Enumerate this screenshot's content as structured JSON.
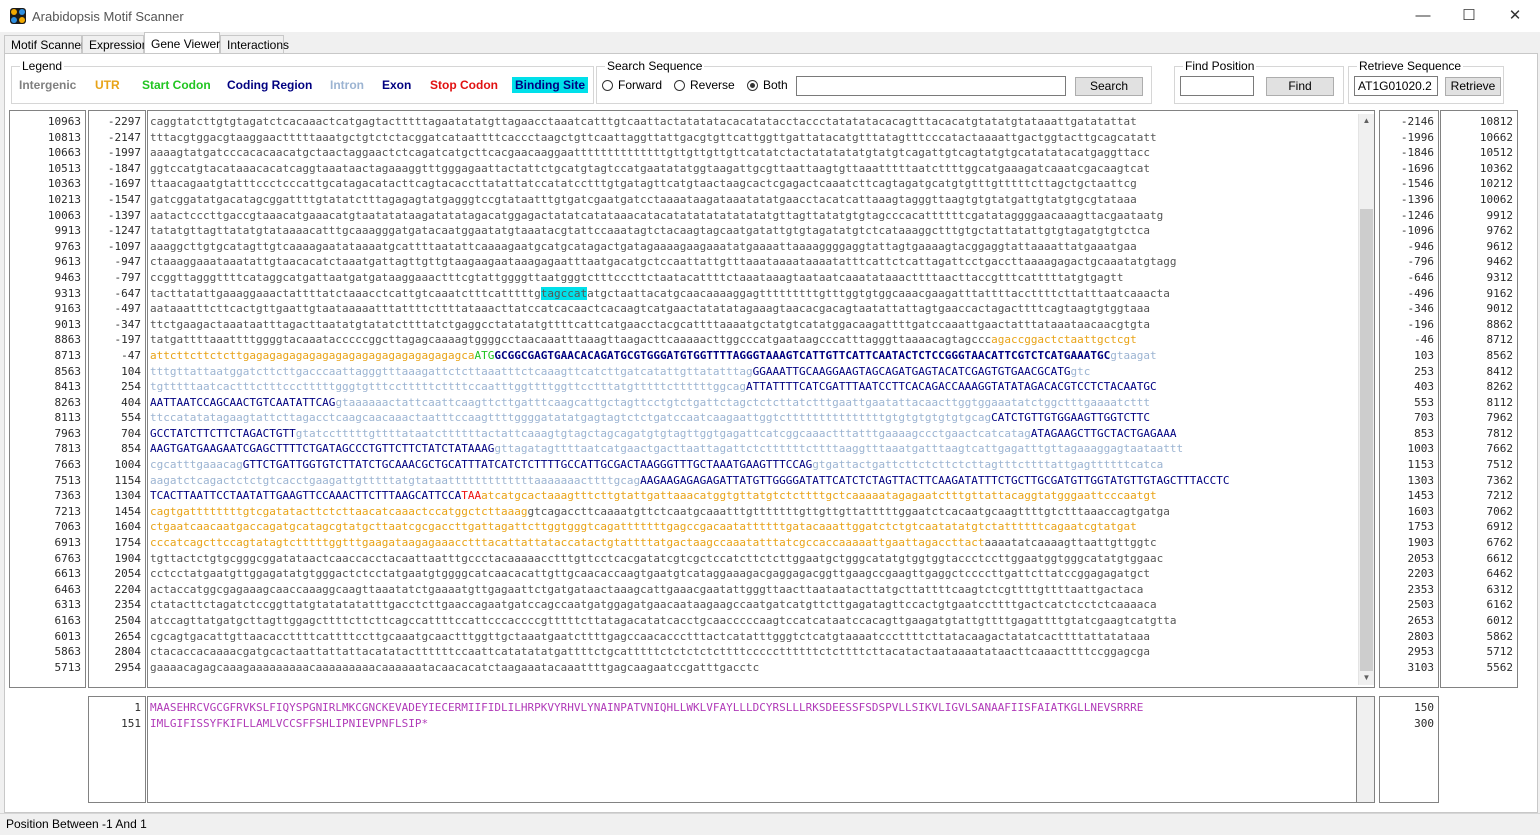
{
  "window": {
    "title": "Arabidopsis Motif Scanner",
    "minimize": "—",
    "maximize": "☐",
    "close": "✕"
  },
  "tabs": [
    {
      "label": "Motif Scanner"
    },
    {
      "label": "Expression"
    },
    {
      "label": "Gene Viewer"
    },
    {
      "label": "Interactions"
    }
  ],
  "legend": {
    "title": "Legend",
    "items": [
      {
        "label": "Intergenic",
        "color": "#808080"
      },
      {
        "label": "UTR",
        "color": "#e8a317"
      },
      {
        "label": "Start Codon",
        "color": "#21c521"
      },
      {
        "label": "Coding Region",
        "color": "#000080"
      },
      {
        "label": "Intron",
        "color": "#9cb4d2"
      },
      {
        "label": "Exon",
        "color": "#000080"
      },
      {
        "label": "Stop Codon",
        "color": "#e11111"
      },
      {
        "label": "Binding Site",
        "color": "#000080",
        "background": "#00e0ea"
      }
    ]
  },
  "search": {
    "title": "Search Sequence",
    "forward": "Forward",
    "reverse": "Reverse",
    "both": "Both",
    "selected": "Both",
    "value": "",
    "button": "Search"
  },
  "find": {
    "title": "Find Position",
    "value": "",
    "button": "Find"
  },
  "retrieve": {
    "title": "Retrieve Sequence",
    "value": "AT1G01020.2",
    "button": "Retrieve"
  },
  "left_abs": [
    "10963",
    "10813",
    "10663",
    "10513",
    "10363",
    "10213",
    "10063",
    "9913",
    "9763",
    "9613",
    "9463",
    "9313",
    "9163",
    "9013",
    "8863",
    "8713",
    "8563",
    "8413",
    "8263",
    "8113",
    "7963",
    "7813",
    "7663",
    "7513",
    "7363",
    "7213",
    "7063",
    "6913",
    "6763",
    "6613",
    "6463",
    "6313",
    "6163",
    "6013",
    "5863",
    "5713"
  ],
  "left_rel": [
    "-2297",
    "-2147",
    "-1997",
    "-1847",
    "-1697",
    "-1547",
    "-1397",
    "-1247",
    "-1097",
    "-947",
    "-797",
    "-647",
    "-497",
    "-347",
    "-197",
    "-47",
    "104",
    "254",
    "404",
    "554",
    "704",
    "854",
    "1004",
    "1154",
    "1304",
    "1454",
    "1604",
    "1754",
    "1904",
    "2054",
    "2204",
    "2354",
    "2504",
    "2654",
    "2804",
    "2954"
  ],
  "right_rel": [
    "-2146",
    "-1996",
    "-1846",
    "-1696",
    "-1546",
    "-1396",
    "-1246",
    "-1096",
    "-946",
    "-796",
    "-646",
    "-496",
    "-346",
    "-196",
    "-46",
    "103",
    "253",
    "403",
    "553",
    "703",
    "853",
    "1003",
    "1153",
    "1303",
    "1453",
    "1603",
    "1753",
    "1903",
    "2053",
    "2203",
    "2353",
    "2503",
    "2653",
    "2803",
    "2953",
    "3103"
  ],
  "right_abs": [
    "10812",
    "10662",
    "10512",
    "10362",
    "10212",
    "10062",
    "9912",
    "9762",
    "9612",
    "9462",
    "9312",
    "9162",
    "9012",
    "8862",
    "8712",
    "8562",
    "8412",
    "8262",
    "8112",
    "7962",
    "7812",
    "7662",
    "7512",
    "7362",
    "7212",
    "7062",
    "6912",
    "6762",
    "6612",
    "6462",
    "6312",
    "6162",
    "6012",
    "5862",
    "5712",
    "5562"
  ],
  "sequence": [
    [
      [
        "i",
        "caggtatcttgtgtagatctcacaaactcatgagtactttttagaatatatgttagaacctaaatcatttgtcaattactatatatacacatatacctaccctatatatacacagtttacacatgtatatgtataaattgatatattat"
      ]
    ],
    [
      [
        "i",
        "tttacgtggacgtaaggaactttttaaatgctgtctctacggatcataattttcaccctaagctgttcaattaggttattgacgtgttcattggttgattatacatgtttatagtttcccatactaaaattgactggtacttgcagcatatt"
      ]
    ],
    [
      [
        "i",
        "aaaagtatgatcccacacaacatgctaactaggaactctcagatcatgcttcacgaacaaggaattttttttttttttgttgttgttgttcatatctactatatatatgtatgtcagattgtcagtatgtgcatatatacatgaggttacc"
      ]
    ],
    [
      [
        "i",
        "ggtccatgtacataaacacatcaggtaaataactagaaaggtttgggagaattactattctgcatgtagtccatgaatatatggtaagattgcgttaattaagtgttaaatttttaatcttttggcatgaaagatcaaatcgacaagtcat"
      ]
    ],
    [
      [
        "i",
        "ttaacagaatgtatttccctcccattgcatagacatacttcagtacaccttatattatccatatcctttgtgatagttcatgtaactaagcactcgagactcaaatcttcagtagatgcatgtgtttgtttttcttagctgctaattcg"
      ]
    ],
    [
      [
        "i",
        "gatcggatatgacatagcggattttgtatatctttagagagtatgagggtccgtataatttgtgatcgaatgatcctaaaataagataaatatatgaacctacatcattaaagtagggttaagtgtgtatgattgtatgtgcgtataaa"
      ]
    ],
    [
      [
        "i",
        "aatactcccttgaccgtaaacatgaaacatgtaatatataagatatatagacatggagactatatcatataaacatacatatatatatatatatgttagttatatgtgtagcccacattttttcgatataggggaacaaagttacgaataatg"
      ]
    ],
    [
      [
        "i",
        "tatatgttagttatatgtataaaacatttgcaaagggatgatacaatggaatatgtaaatacgtattccaaatagtctacaagtagcaatgatattgtgtagatatgtctcataaaggctttgtgctattatattgtgtagatgtgtctca"
      ]
    ],
    [
      [
        "i",
        "aaaggcttgtgcatagttgtcaaaagaatataaaatgcattttaatattcaaaagaatgcatgcatagactgatagaaaagaagaaatatgaaaattaaaaggggaggtattagtgaaaagtacggaggtattaaaattatgaaatgaa"
      ]
    ],
    [
      [
        "i",
        "ctaaaggaaataaatattgtaacacatctaaatgattagttgttgtaagaagaataaagagaatttaatgacatgctccaattattgtttaaataaaataaaatatttcattctcattagattcctgaccttaaaagagactgcaaatatgtagg"
      ]
    ],
    [
      [
        "i",
        "ccggttagggttttcataggcatgattaatgatgataaggaaactttcgtattggggttaatgggtctttcccttctaatacattttctaaataaagtaataatcaaatataaacttttaacttaccgtttcatttttatgtgagtt"
      ]
    ],
    [
      [
        "i",
        "tacttatattgaaaggaaactattttatctaaacctcattgtcaaatctttcatttttg"
      ],
      [
        "b",
        "tagccat"
      ],
      [
        "i",
        "atgctaattacatgcaacaaaaggagtttttttttgtttggtgtggcaaacgaagatttattttaccttttcttatttaatcaaacta"
      ]
    ],
    [
      [
        "i",
        "aataaatttcttcactgttgaattgtaataaaaatttattttcttttataaacttatccatcacaactcacaagtcatgaactatatatagaaagtaacacgacagtaatattattagtgaaccactagacttttcagtaagtgtggtaaa"
      ]
    ],
    [
      [
        "i",
        "ttctgaagactaaataatttagacttaatatgtatatcttttatctgaggcctatatatgttttcattcatgaacctacgcattttaaaatgctatgtcatatggacaagattttgatccaaattgaactatttataaataacaacgtgta"
      ]
    ],
    [
      [
        "i",
        "tatgattttaaattttggggtacaaatacccccggcttagagcaaaagtggggcctaacaaatttaaagttaagacttcaaaaacttggcccatgaataagcccatttagggttaaaacagtagccc"
      ],
      [
        "u",
        "agaccggactctaattgctcgt"
      ]
    ],
    [
      [
        "u",
        "attcttcttctcttgagagagagagagagagagagagagagagagagca"
      ],
      [
        "s",
        "ATG"
      ],
      [
        "c",
        "GCGGCGAGTGAACACAGATGCGTGGGATGTGGTTTTAGGGTAAAGTCATTGTTCATTCAATACTCTCCGGGTAACATTCGTCTCATGAAATGC"
      ],
      [
        "n",
        "gtaagat"
      ]
    ],
    [
      [
        "n",
        "tttgttattaatggatcttcttgacccaattagggtttaaagattctcttaaatttctcaaagttcatcttgatcatattgttatatttag"
      ],
      [
        "e",
        "GGAAATTGCAAGGAAGTAGCAGATGAGTACATCGAGTGTGAACGCATG"
      ],
      [
        "n",
        "gtc"
      ]
    ],
    [
      [
        "n",
        "tgtttttaatcactttctttccctttttgggtgtttcctttttcttttccaatttggttttggttcctttatgtttttcttttttggcag"
      ],
      [
        "e",
        "ATTATTTTCATCGATTTAATCCTTCACAGACCAAAGGTATATAGACACGTCCTCTACAATGC"
      ]
    ],
    [
      [
        "e",
        "AATTAATCCAGCAACTGTCAATATTCAG"
      ],
      [
        "n",
        "gtaaaaaactattcaattcaagttcttgatttcaagcattgctagttcctgtctgattctagctctcttatctttgaattgaatattacaacttggtggaaatatctggctttgaaaatcttt"
      ]
    ],
    [
      [
        "n",
        "ttccatatatagaagtattcttagacctcaagcaacaaactaatttccaagttttggggatatatgagtagtctctgatccaatcaagaattggtctttttttttttttttgtgtgtgtgtgtgcag"
      ],
      [
        "e",
        "CATCTGTTGTGGAAGTTGGTCTTC"
      ]
    ],
    [
      [
        "e",
        "GCCTATCTTCTTCTAGACTGTT"
      ],
      [
        "n",
        "gtatcctttttgttttataatcttttttactattcaaagtgtagctagcagatgtgtagttggtgagattcatcggcaaactttatttgaaaagccctgaactcatcatag"
      ],
      [
        "e",
        "ATAGAAGCTTGCTACTGAGAAA"
      ]
    ],
    [
      [
        "e",
        "AAGTGATGAAGAATCGAGCTTTTCTGATAGCCCTGTTCTTCTATCTATAAAG"
      ],
      [
        "n",
        "gttagatagttttaatcatgaactgacttaattagattctcttttttcttttaaggtttaaatgatttaagtcattgagatttgttagaaaggagtaataattt"
      ]
    ],
    [
      [
        "n",
        "cgcatttgaaacag"
      ],
      [
        "e",
        "GTTCTGATTGGTGTCTTATCTGCAAACGCTGCATTTATCATCTCTTTTGCCATTGCGACTAAGGGTTTGCTAAATGAAGTTTCCAG"
      ],
      [
        "n",
        "gtgattactgattcttctcttctcttagtttcttttattgagttttttcatca"
      ]
    ],
    [
      [
        "n",
        "aagatctcagactctctgtcacctgaagattgtttttatgtataatttttttttttttaaaaaaacttttgcag"
      ],
      [
        "e",
        "AAGAAGAGAGAGATTATGTTGGGGATATTCATCTCTAGTTACTTCAAGATATTTCTGCTTGCGATGTTGGTATGTTGTAGCTTTACCTC"
      ]
    ],
    [
      [
        "e",
        "TCACTTAATTCCTAATATTGAAGTTCCAAACTTCTTTAAGCATTCCA"
      ],
      [
        "t",
        "TAA"
      ],
      [
        "u",
        "atcatgcactaaagtttcttgtattgattaaacatggtgttatgtctcttttgctcaaaaatagagaatctttgttattacaggtatgggaattcccaatgt"
      ]
    ],
    [
      [
        "u",
        "cagtgattttttttgtcgatatacttctcttaacatcaaactccatggctcttaaag"
      ],
      [
        "i",
        "gtcagaccttcaaaatgttctcaatgcaaatttgtttttttgttgttgttatttttggaatctcacaatgcaagttttgtctttaaaccagtgatga"
      ]
    ],
    [
      [
        "u",
        "ctgaatcaacaatgaccagatgcatagcgtatgcttaatcgcgaccttgattagattcttggtgggtcagatttttttgagccgacaatattttttgatacaaattggatctctgtcaatatatgtctattttttcagaatcgtatgat"
      ]
    ],
    [
      [
        "u",
        "cccatcagcttccagtatagtctttttggtttgaagataagagaaacctttacattattataccatactgtattttatgactaagccaaatatttatcgccaccaaaaattgaattagaccttact"
      ],
      [
        "i",
        "aaaatatcaaaagttaattgttggtc"
      ]
    ],
    [
      [
        "i",
        "tgttactctgtgcgggcggatataactcaaccacctacaattaatttgccctacaaaaacctttgttcctcacgatatcgtcgctccatcttctcttggaatgctgggcatatgtggtggtaccctccttggaatggtgggcatatgtggaac"
      ]
    ],
    [
      [
        "i",
        "cctcctatgaatgttggagatatgtgggactctcctatgaatgtggggcatcaacacattgttgcaacaccaagtgaatgtcataggaaagacgaggagacggttgaagccgaagttgaggctccccttgattcttatccggagagatgct"
      ]
    ],
    [
      [
        "i",
        "actaccatggcgagaaagcaaccaaaggcaagttaaatatctgaaaatgttgagaattctgatgataactaaagcattgaaacgaatattgggttaacttaataatacttatgcttattttcaagtctcgttttgttttaattgactaca"
      ]
    ],
    [
      [
        "i",
        "ctatacttctagatctccggttatgtatatatatttgacctcttgaaccagaatgatccagccaatgatggagatgaacaataagaagccaatgatcatgttcttgagatagttccactgtgaatccttttgactcatctcctctcaaaaca"
      ]
    ],
    [
      [
        "i",
        "atccagttatgatgcttagttggagcttttcttcttcagccattttccattcccaccccgtttttcttatagacatatcacctgcaacccccaagtccatcataatccacagttgaagatgtattgttttgagattttgtatcgaagtcatgtta"
      ]
    ],
    [
      [
        "i",
        "cgcagtgacattgttaacaccttttcattttccttgcaaatgcaactttggttgctaaatgaatcttttgagccaacaccctttactcatatttgggtctcatgtaaaatcccttttcttatacaagactatatcacttttattatataaa"
      ]
    ],
    [
      [
        "i",
        "ctacaccacaaaacgatgcactaattattattacatatacttttttccaattcatatatatgattttctgcatttttctctctctcttttcccccttttttctcttttcttacatactaataaaatataacttcaaacttttccggagcga"
      ]
    ],
    [
      [
        "i",
        "gaaaacagagcaaagaaaaaaaaacaaaaaaaaacaaaaaatacaacacatctaagaaatacaaattttgagcaagaatccgatttgacctc"
      ]
    ]
  ],
  "protein": {
    "numbers_left": [
      "1",
      "151"
    ],
    "numbers_right": [
      "150",
      "300"
    ],
    "lines": [
      "MAASEHRCVGCGFRVKSLFIQYSPGNIRLMKCGNCKEVADEYIECERMIIFIDLILHRPKVYRHVLYNAINPATVNIQHLLWKLVFAYLLLDCYRSLLLRKSDEESSFSDSPVLLSIKVLIGVLSANAAFIISFAIATKGLLNEVSRRRE",
      "IMLGIFISSYFKIFLLAMLVCCSFFSHLIPNIEVPNFLSIP*"
    ]
  },
  "status": {
    "text": "Position Between -1 And 1"
  }
}
